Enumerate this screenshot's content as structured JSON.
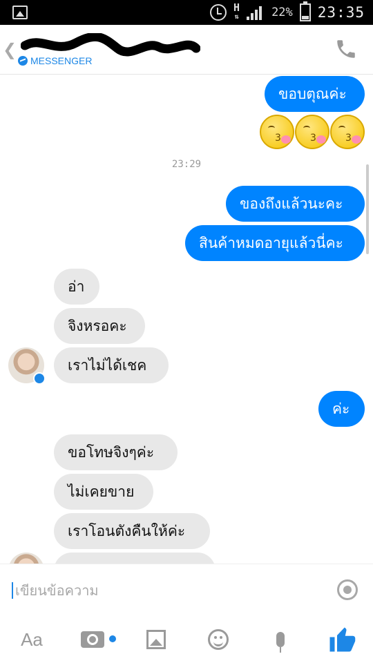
{
  "status_bar": {
    "network_type": "H",
    "battery_percent": "22%",
    "time": "23:35"
  },
  "header": {
    "app_label": "MESSENGER"
  },
  "messages": [
    {
      "text": "ขอบตุณค่ะ",
      "side": "out"
    },
    {
      "text": "ของถึงแล้วนะคะ",
      "side": "out"
    },
    {
      "text": "สินค้าหมดอายุแล้วนี่คะ",
      "side": "out"
    },
    {
      "text": "อ่า",
      "side": "in"
    },
    {
      "text": "จิงหรอคะ",
      "side": "in"
    },
    {
      "text": "เราไม่ได้เชค",
      "side": "in"
    },
    {
      "text": "ค่ะ",
      "side": "out"
    },
    {
      "text": "ขอโทษจิงๆค่ะ",
      "side": "in"
    },
    {
      "text": "ไม่เคยขาย",
      "side": "in"
    },
    {
      "text": "เราโอนตังคืนให้ค่ะ",
      "side": "in"
    }
  ],
  "timestamp": "23:29",
  "emojis": [
    {
      "icon": "kissing-emoji",
      "glyph": "3"
    },
    {
      "icon": "kissing-emoji",
      "glyph": "3"
    },
    {
      "icon": "kissing-emoji",
      "glyph": "3"
    }
  ],
  "composer": {
    "placeholder": "เขียนข้อความ"
  },
  "toolbar": {
    "text_button": "Aa"
  },
  "colors": {
    "outgoing_bubble": "#0084ff",
    "incoming_bubble": "#e8e8e8",
    "accent": "#1d87e6"
  }
}
